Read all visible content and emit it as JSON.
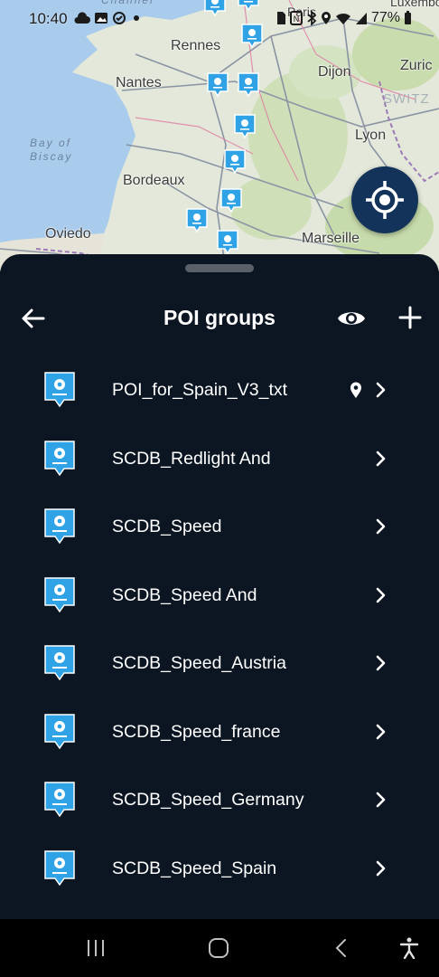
{
  "status_bar": {
    "time": "10:40",
    "battery": "77%",
    "icons": [
      "cloud-icon",
      "image-icon",
      "sync-icon",
      "dot-icon",
      "sim-icon",
      "nfc-icon",
      "bluetooth-icon",
      "location-icon",
      "wifi-icon",
      "signal-icon",
      "battery-icon"
    ]
  },
  "map": {
    "places": [
      "Rennes",
      "Nantes",
      "Bordeaux",
      "Oviedo",
      "Dijon",
      "Lyon",
      "Marseille",
      "Zuric",
      "Luxembo",
      "Paris"
    ],
    "sea_label": "Bay of\nBiscay",
    "channel_label": "Channel",
    "switz_label": "SWITZ"
  },
  "sheet": {
    "title": "POI groups",
    "back_icon": "arrow-left-icon",
    "visibility_icon": "eye-icon",
    "add_icon": "plus-icon"
  },
  "poi_groups": [
    {
      "label": "POI_for_Spain_V3_txt",
      "has_pin": true
    },
    {
      "label": "SCDB_Redlight And",
      "has_pin": false
    },
    {
      "label": "SCDB_Speed",
      "has_pin": false
    },
    {
      "label": "SCDB_Speed And",
      "has_pin": false
    },
    {
      "label": "SCDB_Speed_Austria",
      "has_pin": false
    },
    {
      "label": "SCDB_Speed_france",
      "has_pin": false
    },
    {
      "label": "SCDB_Speed_Germany",
      "has_pin": false
    },
    {
      "label": "SCDB_Speed_Spain",
      "has_pin": false
    }
  ],
  "colors": {
    "sheet_bg": "#0b1622",
    "poi_icon": "#2fa3e6",
    "locate_button": "#14335a",
    "sea": "#a9cbec"
  },
  "nav_bar": {
    "icons": [
      "recent-apps-icon",
      "home-icon",
      "back-icon",
      "accessibility-icon"
    ]
  }
}
